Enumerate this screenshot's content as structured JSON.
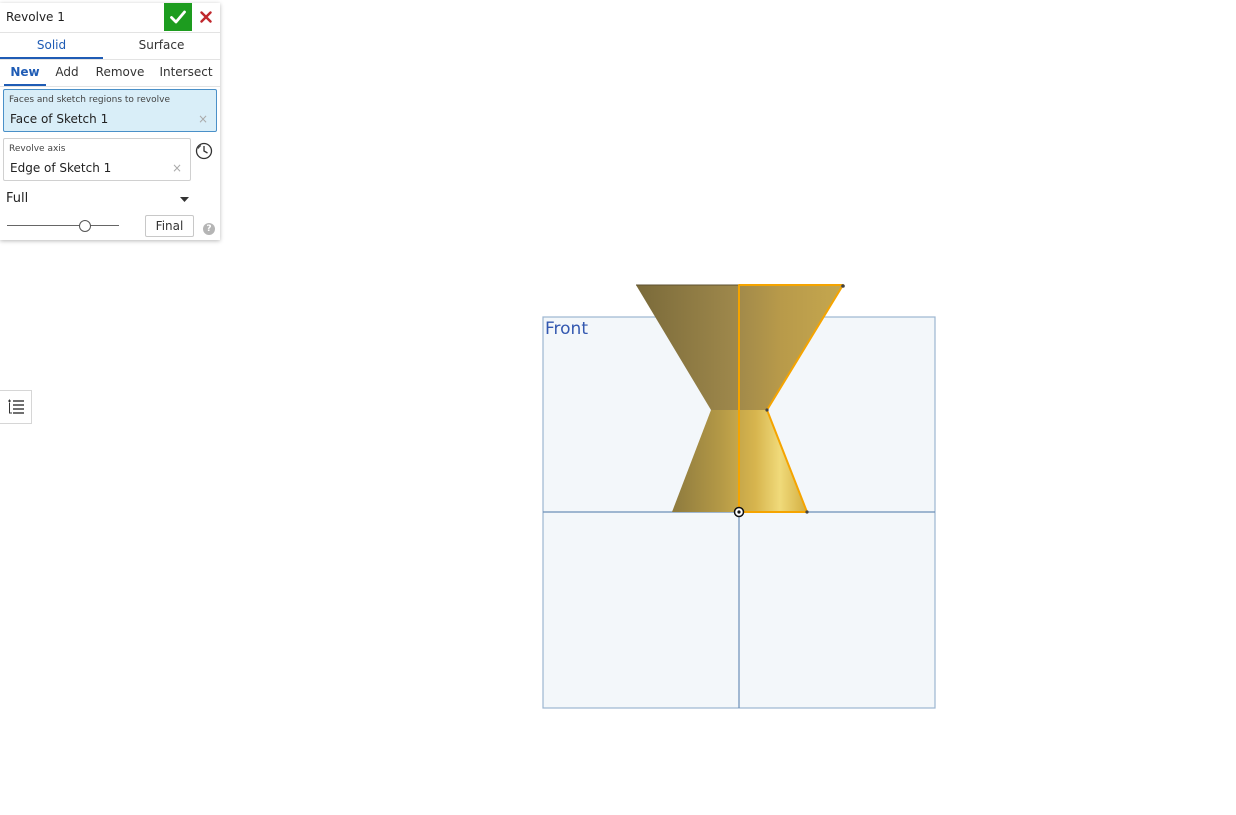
{
  "dialog": {
    "title": "Revolve 1",
    "accept_icon": "checkmark-icon",
    "cancel_icon": "close-icon",
    "accent_color": "#1d9c1f",
    "cancel_color": "#c0282d",
    "type_tabs": [
      {
        "label": "Solid",
        "active": true
      },
      {
        "label": "Surface",
        "active": false
      }
    ],
    "operation_tabs": [
      {
        "label": "New",
        "active": true
      },
      {
        "label": "Add",
        "active": false
      },
      {
        "label": "Remove",
        "active": false
      },
      {
        "label": "Intersect",
        "active": false
      }
    ],
    "faces_field": {
      "label": "Faces and sketch regions to revolve",
      "value": "Face of Sketch 1",
      "clear": "×"
    },
    "axis_field": {
      "label": "Revolve axis",
      "value": "Edge of Sketch 1",
      "clear": "×"
    },
    "revolve_type": "Full",
    "rollback_slider_level": 0.7,
    "final_button": "Final",
    "help_icon": "?"
  },
  "viewport": {
    "plane_label": "Front",
    "plane_color": "#3358b0",
    "part_color": "#d9b84a",
    "highlight_color": "#f5a400"
  }
}
